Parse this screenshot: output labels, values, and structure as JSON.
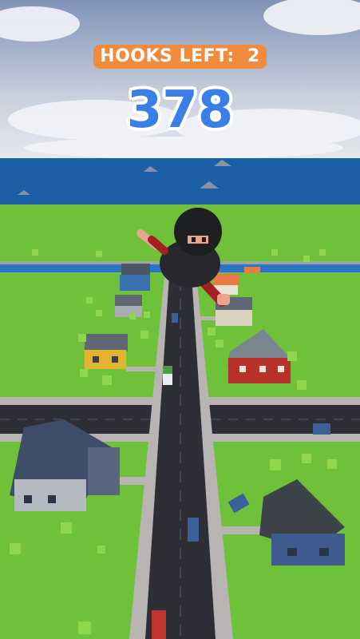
{
  "hud": {
    "hooks_label": "HOOKS LEFT:",
    "hooks_count": "2",
    "score": "378"
  },
  "colors": {
    "sky_top": "#7f93b8",
    "sky_horizon": "#d9dde8",
    "sea": "#1d5fa5",
    "grass": "#6fc13a",
    "road": "#2e2f36",
    "sidewalk": "#b9b4b4",
    "hooks_pill": "#f28a3c",
    "score_text": "#3a7ee8"
  }
}
